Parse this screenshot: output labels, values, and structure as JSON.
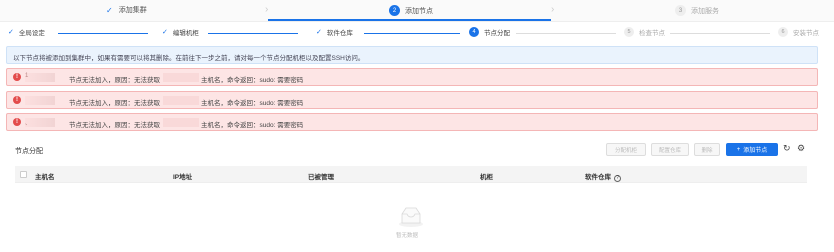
{
  "top_steps": [
    {
      "label": "添加集群",
      "state": "done"
    },
    {
      "label": "添加节点",
      "state": "active",
      "num": "2"
    },
    {
      "label": "添加服务",
      "state": "todo",
      "num": "3"
    }
  ],
  "sub_steps": [
    {
      "label": "全局设定",
      "state": "done"
    },
    {
      "label": "编辑机柜",
      "state": "done"
    },
    {
      "label": "软件仓库",
      "state": "done"
    },
    {
      "label": "节点分配",
      "state": "active",
      "num": "4"
    },
    {
      "label": "检查节点",
      "state": "todo",
      "num": "5"
    },
    {
      "label": "安装节点",
      "state": "todo",
      "num": "6"
    }
  ],
  "info_text": "以下节点将被添加到集群中，如果有需要可以将其删除。在前往下一步之前，请对每一个节点分配机柜以及配置SSH访问。",
  "alerts": [
    {
      "prefix": "1",
      "text1": "节点无法加入，原因：无法获取",
      "text2": "主机名，命令返回：sudo: 需要密码"
    },
    {
      "prefix": "",
      "text1": "节点无法加入，原因：无法获取",
      "text2": "主机名，命令返回：sudo: 需要密码"
    },
    {
      "prefix": "、",
      "text1": "节点无法加入，原因：无法获取",
      "text2": "主机名，命令返回：sudo: 需要密码"
    }
  ],
  "section_title": "节点分配",
  "buttons": {
    "assign_rack": "分配机柜",
    "config_repo": "配置仓库",
    "delete": "删除",
    "add_node": "添加节点"
  },
  "table_columns": [
    "主机名",
    "IP地址",
    "已被管理",
    "机柜",
    "软件仓库"
  ],
  "empty_text": "暂无数据",
  "colors": {
    "primary": "#1a73e8",
    "alert_bg": "#fde5e5",
    "info_bg": "#eaf3fd"
  }
}
